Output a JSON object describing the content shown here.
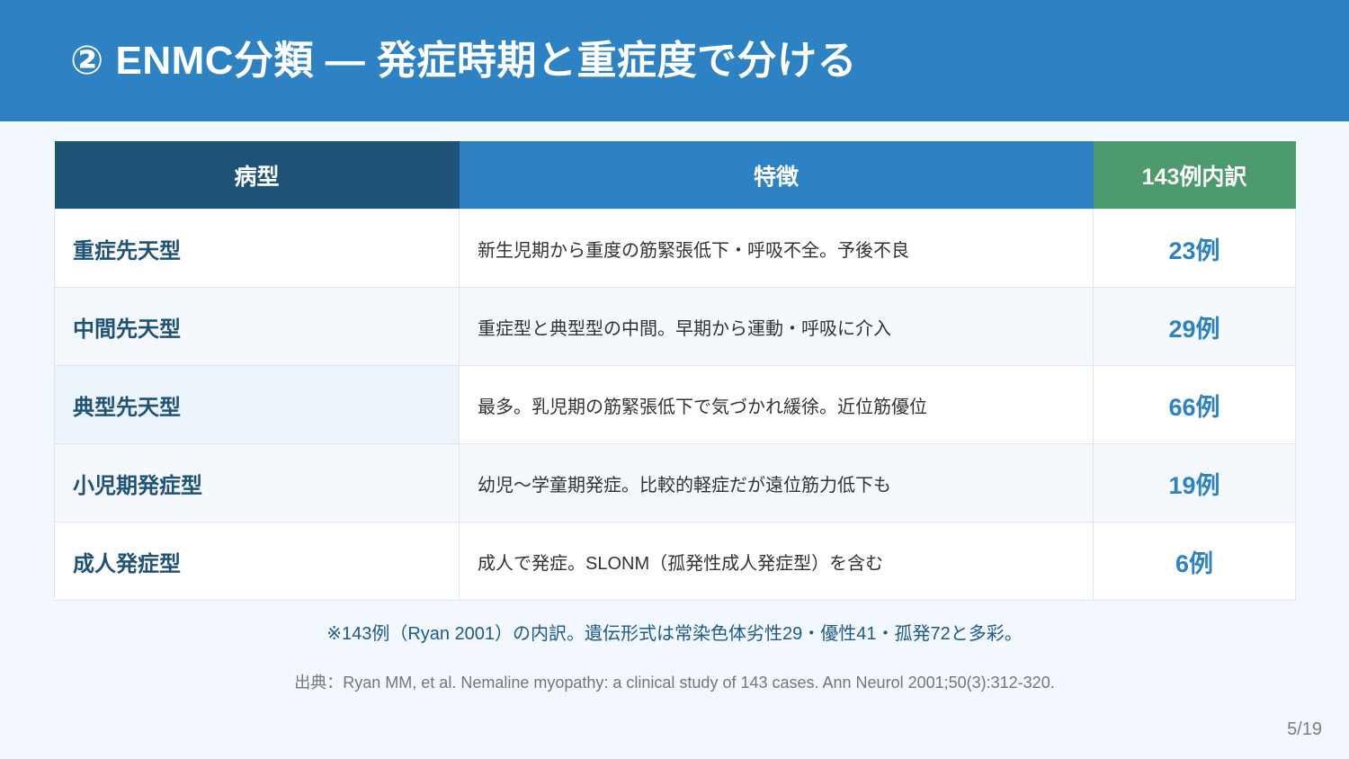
{
  "slide": {
    "title": "② ENMC分類 — 発症時期と重症度で分ける",
    "page_number": "5/19"
  },
  "table": {
    "headers": {
      "type": "病型",
      "features": "特徴",
      "count": "143例内訳"
    },
    "rows": [
      {
        "type": "重症先天型",
        "features": "新生児期から重度の筋緊張低下・呼吸不全。予後不良",
        "count": "23例"
      },
      {
        "type": "中間先天型",
        "features": "重症型と典型型の中間。早期から運動・呼吸に介入",
        "count": "29例"
      },
      {
        "type": "典型先天型",
        "features": "最多。乳児期の筋緊張低下で気づかれ緩徐。近位筋優位",
        "count": "66例"
      },
      {
        "type": "小児期発症型",
        "features": "幼児〜学童期発症。比較的軽症だが遠位筋力低下も",
        "count": "19例"
      },
      {
        "type": "成人発症型",
        "features": "成人で発症。SLONM（孤発性成人発症型）を含む",
        "count": "6例"
      }
    ]
  },
  "note": "※143例（Ryan 2001）の内訳。遺伝形式は常染色体劣性29・優性41・孤発72と多彩。",
  "source": "出典：Ryan MM, et al. Nemaline myopathy: a clinical study of 143 cases. Ann Neurol 2001;50(3):312-320.",
  "colors": {
    "header_bg": "#2c82c2",
    "type_header_bg": "#1e5276",
    "count_header_bg": "#4c9a6e",
    "count_text": "#2c82c2"
  }
}
